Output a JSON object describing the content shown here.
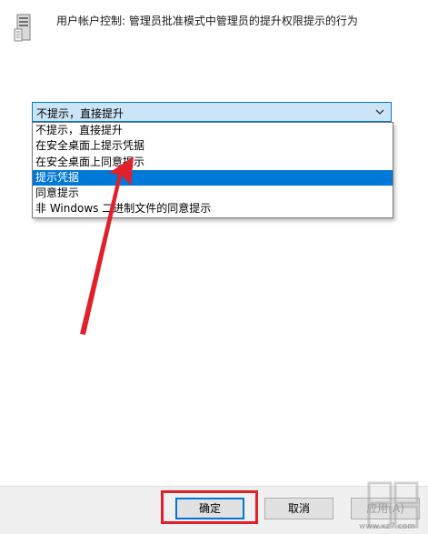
{
  "policy": {
    "icon": "policy-server-icon",
    "title": "用户帐户控制: 管理员批准模式中管理员的提升权限提示的行为"
  },
  "combo": {
    "value": "不提示，直接提升",
    "arrow_icon": "chevron-down-icon"
  },
  "dropdown": {
    "options": [
      {
        "label": "不提示，直接提升",
        "selected": false
      },
      {
        "label": "在安全桌面上提示凭据",
        "selected": false
      },
      {
        "label": "在安全桌面上同意提示",
        "selected": false
      },
      {
        "label": "提示凭据",
        "selected": true
      },
      {
        "label": "同意提示",
        "selected": false
      },
      {
        "label": "非 Windows 二进制文件的同意提示",
        "selected": false
      }
    ]
  },
  "buttons": {
    "ok_label": "确定",
    "cancel_label": "取消",
    "apply_label": "应用(A)"
  },
  "annotation": {
    "arrow_color": "#e0202a",
    "highlight_color": "#e0202a"
  },
  "colors": {
    "accent": "#0078d7",
    "combo_bg": "#cce4f7",
    "button_bar_bg": "#f0f0f0"
  },
  "watermark": {
    "text": "www.xz7.com"
  }
}
